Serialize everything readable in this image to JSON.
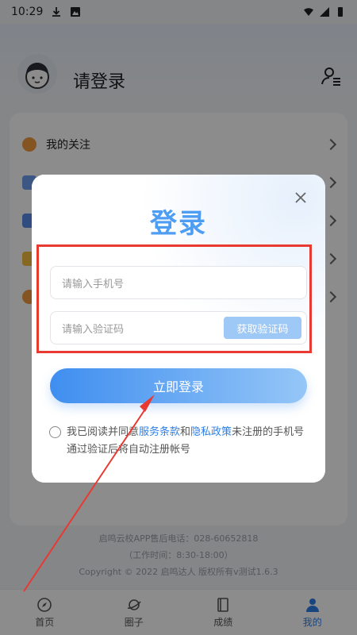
{
  "status_bar": {
    "time": "10:29"
  },
  "header": {
    "title": "请登录"
  },
  "list": {
    "items": [
      {
        "label": "我的关注",
        "icon_color": "#f09a3e"
      },
      {
        "label": "",
        "icon_color": "#6d9ff0"
      },
      {
        "label": "",
        "icon_color": "#5a8de8"
      },
      {
        "label": "",
        "icon_color": "#f4bd41"
      },
      {
        "label": "",
        "icon_color": "#f09a3e"
      }
    ]
  },
  "footer": {
    "line1": "启鸣云校APP售后电话：028-60652818",
    "line2": "（工作时间：8:30-18:00）",
    "line3": "Copyright © 2022 启鸣达人 版权所有v测试1.6.3"
  },
  "tabs": [
    {
      "label": "首页",
      "icon": "compass-icon",
      "active": false
    },
    {
      "label": "圈子",
      "icon": "planet-icon",
      "active": false
    },
    {
      "label": "成绩",
      "icon": "book-icon",
      "active": false
    },
    {
      "label": "我的",
      "icon": "user-icon",
      "active": true
    }
  ],
  "modal": {
    "title": "登录",
    "phone_placeholder": "请输入手机号",
    "code_placeholder": "请输入验证码",
    "get_code_label": "获取验证码",
    "login_label": "立即登录",
    "agree_prefix": "我已阅读并同意",
    "terms_link": "服务条款",
    "and": "和",
    "privacy_link": "隐私政策",
    "agree_suffix": "未注册的手机号通过验证后将自动注册帐号"
  },
  "colors": {
    "accent": "#2d7fe8",
    "title_blue": "#4d9df3",
    "highlight_red": "#e83a31"
  }
}
